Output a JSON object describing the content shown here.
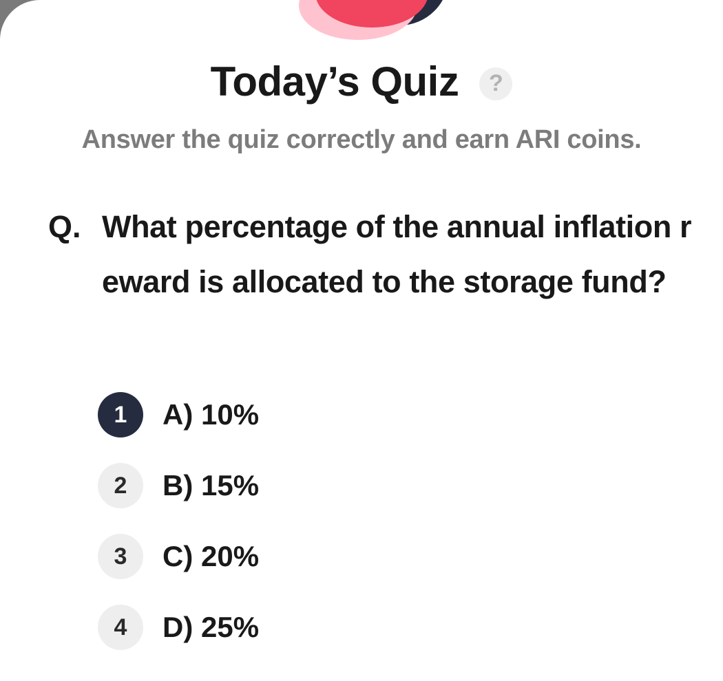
{
  "header": {
    "title": "Today’s Quiz",
    "help_icon_glyph": "?",
    "subtitle": "Answer the quiz correctly and earn ARI coins."
  },
  "question": {
    "prefix": "Q.",
    "text": "What percentage of the annual inflation reward is allocated to the storage fund?"
  },
  "options": [
    {
      "number": "1",
      "label": "A) 10%",
      "selected": true
    },
    {
      "number": "2",
      "label": "B) 15%",
      "selected": false
    },
    {
      "number": "3",
      "label": "C) 20%",
      "selected": false
    },
    {
      "number": "4",
      "label": "D) 25%",
      "selected": false
    }
  ],
  "colors": {
    "title": "#191919",
    "subtitle": "#7c7c7c",
    "selected_badge": "#262c3f",
    "badge": "#eeeeee",
    "illustration_red": "#f0445f",
    "illustration_pink": "#ffc3cf",
    "illustration_navy": "#262c3f"
  }
}
